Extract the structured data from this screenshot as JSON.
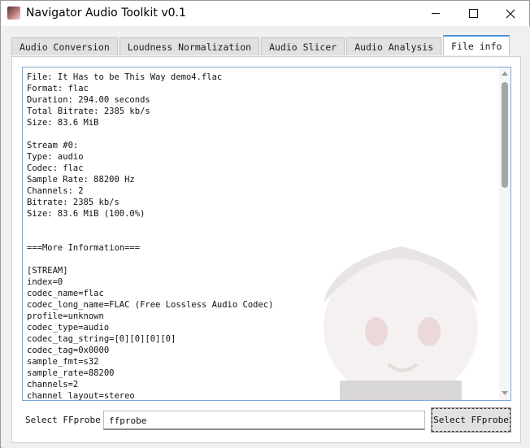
{
  "window": {
    "title": "Navigator Audio Toolkit v0.1"
  },
  "tabs": [
    {
      "label": "Audio Conversion",
      "active": false
    },
    {
      "label": "Loudness Normalization",
      "active": false
    },
    {
      "label": "Audio Slicer",
      "active": false
    },
    {
      "label": "Audio Analysis",
      "active": false
    },
    {
      "label": "File info",
      "active": true
    }
  ],
  "file_info": {
    "lines": [
      "File: It Has to be This Way demo4.flac",
      "Format: flac",
      "Duration: 294.00 seconds",
      "Total Bitrate: 2385 kb/s",
      "Size: 83.6 MiB",
      "",
      "Stream #0:",
      "Type: audio",
      "Codec: flac",
      "Sample Rate: 88200 Hz",
      "Channels: 2",
      "Bitrate: 2385 kb/s",
      "Size: 83.6 MiB (100.0%)",
      "",
      "",
      "===More Information===",
      "",
      "[STREAM]",
      "index=0",
      "codec_name=flac",
      "codec_long_name=FLAC (Free Lossless Audio Codec)",
      "profile=unknown",
      "codec_type=audio",
      "codec_tag_string=[0][0][0][0]",
      "codec_tag=0x0000",
      "sample_fmt=s32",
      "sample_rate=88200",
      "channels=2",
      "channel_layout=stereo"
    ]
  },
  "ffprobe": {
    "label": "Select FFprobe",
    "value": "ffprobe",
    "button_label": "Select FFprobe"
  },
  "colors": {
    "active_tab_accent": "#4a90d9",
    "textbox_border": "#7aa7d8"
  }
}
